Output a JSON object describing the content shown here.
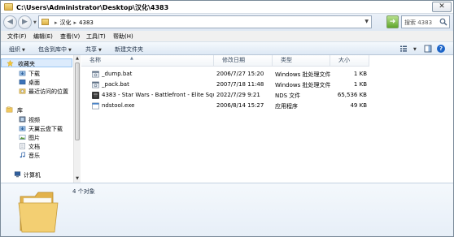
{
  "window": {
    "title": "C:\\Users\\Administrator\\Desktop\\汉化\\4383",
    "close_label": "✕"
  },
  "address": {
    "segments": [
      "汉化",
      "4383"
    ],
    "separator": "▸",
    "search_placeholder": "搜索 4383"
  },
  "menu": [
    "文件(F)",
    "编辑(E)",
    "查看(V)",
    "工具(T)",
    "帮助(H)"
  ],
  "toolbar": {
    "organize": "组织",
    "include_in_library": "包含到库中",
    "share": "共享",
    "new_folder": "新建文件夹",
    "help": "?"
  },
  "nav": {
    "favorites": "收藏夹",
    "downloads": "下载",
    "desktop": "桌面",
    "recent": "最近访问的位置",
    "libraries": "库",
    "videos": "视频",
    "tianyi": "天翼云盘下载",
    "pictures": "图片",
    "documents": "文档",
    "music": "音乐",
    "computer": "计算机"
  },
  "columns": {
    "name": "名称",
    "modified": "修改日期",
    "type": "类型",
    "size": "大小"
  },
  "files": [
    {
      "name": "_dump.bat",
      "modified": "2006/7/27 15:20",
      "type": "Windows 批处理文件",
      "size": "1 KB",
      "icon": "batch-file-icon"
    },
    {
      "name": "_pack.bat",
      "modified": "2007/7/18 11:48",
      "type": "Windows 批处理文件",
      "size": "1 KB",
      "icon": "batch-file-icon"
    },
    {
      "name": "4383 - Star Wars - Battlefront - Elite Squadr...",
      "modified": "2022/7/29 9:21",
      "type": "NDS 文件",
      "size": "65,536 KB",
      "icon": "nds-file-icon"
    },
    {
      "name": "ndstool.exe",
      "modified": "2006/8/14 15:27",
      "type": "应用程序",
      "size": "49 KB",
      "icon": "exe-file-icon"
    }
  ],
  "details": {
    "count": "4 个对象"
  },
  "colors": {
    "accent": "#1d65c8",
    "selection": "#dcebfc",
    "folder": "#f1c85f"
  }
}
